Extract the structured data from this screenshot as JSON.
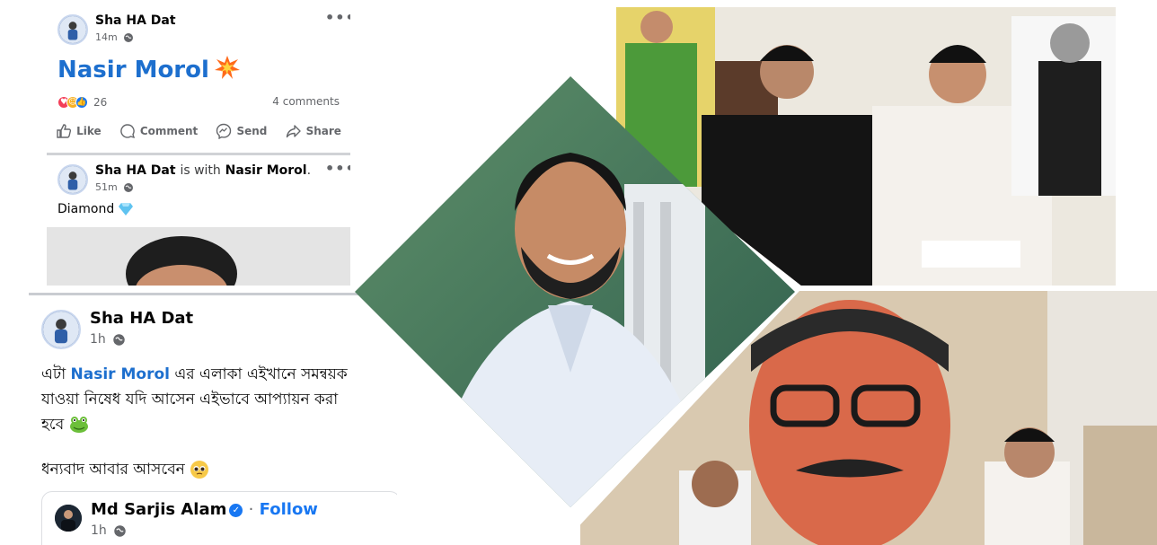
{
  "post1": {
    "author": "Sha HA Dat",
    "time": "14m",
    "title": "Nasir Morol",
    "reaction_count": "26",
    "comments": "4 comments",
    "actions": [
      "Like",
      "Comment",
      "Send",
      "Share"
    ]
  },
  "post2": {
    "author": "Sha HA Dat",
    "with_text": "is with",
    "tagged": "Nasir Morol",
    "tagged_suffix": ".",
    "time": "51m",
    "text": "Diamond"
  },
  "post3": {
    "author": "Sha HA Dat",
    "time": "1h",
    "text_line1_pre": "এটা",
    "text_line1_link": "Nasir Morol",
    "text_line1_post": "এর এলাকা এইখানে সমন্বয়ক",
    "text_line2": "যাওয়া নিষেধ যদি আসেন এইভাবে আপ্যায়ন করা",
    "text_line3": "হবে",
    "text_line4": "ধন্যবাদ আবার আসবেন"
  },
  "quoted": {
    "author": "Md Sarjis Alam",
    "separator": "·",
    "follow": "Follow",
    "time": "1h"
  },
  "colors": {
    "link_blue": "#1d6fce",
    "follow_blue": "#1877f2",
    "meta_gray": "#65676b"
  }
}
